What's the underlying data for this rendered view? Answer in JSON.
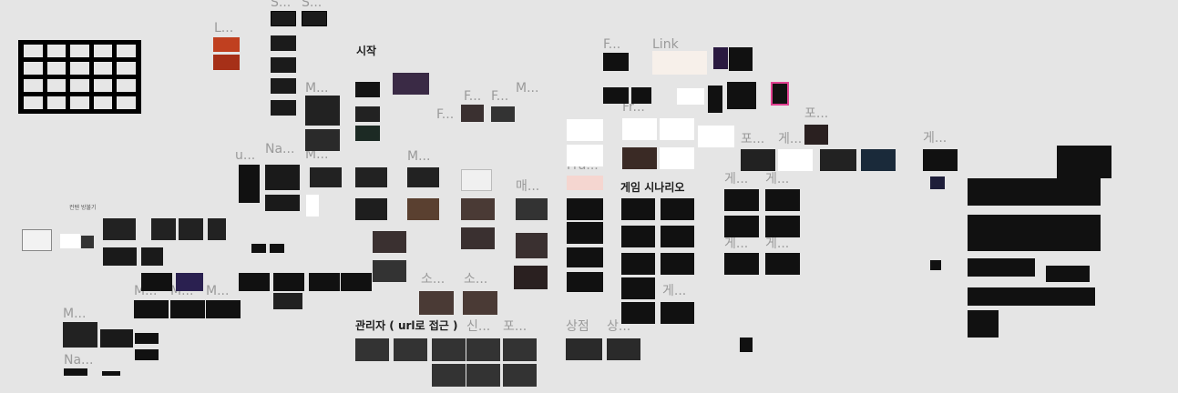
{
  "canvas": {
    "background": "#e5e5e5",
    "labels": {
      "start": "시작",
      "game_scenario": "게임 시나리오",
      "admin": "관리자 ( url로 접근 )",
      "shop": "상점",
      "link": "Link",
      "sang_short": "상...",
      "sin_short": "신...",
      "po_short": "포...",
      "so_short": "소...",
      "mae_short": "매...",
      "ge_short": "게...",
      "m_short": "M...",
      "f_short": "F...",
      "fr_short": "Fr...",
      "fra_short": "Fra...",
      "na_short": "Na...",
      "l_short": "L...",
      "s_short": "S...",
      "u_short": "u...",
      "small_note": "컨텐 방불기"
    }
  }
}
